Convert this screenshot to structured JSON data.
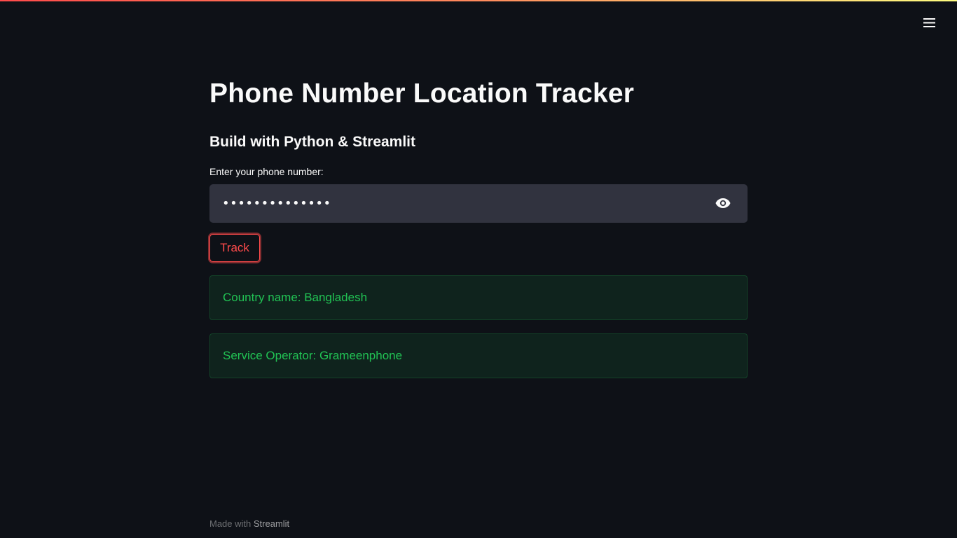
{
  "header": {
    "menu_icon": "hamburger-menu-icon",
    "accent_gradient": [
      "#ff4b4b",
      "#fffd80"
    ]
  },
  "main": {
    "title": "Phone Number Location Tracker",
    "subtitle": "Build with Python & Streamlit",
    "phone_input": {
      "label": "Enter your phone number:",
      "value": "••••••••••••••",
      "visibility_icon": "eye-icon"
    },
    "track_button_label": "Track",
    "results": [
      {
        "text": "Country name: Bangladesh"
      },
      {
        "text": "Service Operator: Grameenphone"
      }
    ]
  },
  "footer": {
    "prefix": "Made with ",
    "link": "Streamlit"
  },
  "colors": {
    "background": "#0e1117",
    "primary": "#ff4b4b",
    "input_bg": "#31333f",
    "success_text": "#21c354"
  }
}
